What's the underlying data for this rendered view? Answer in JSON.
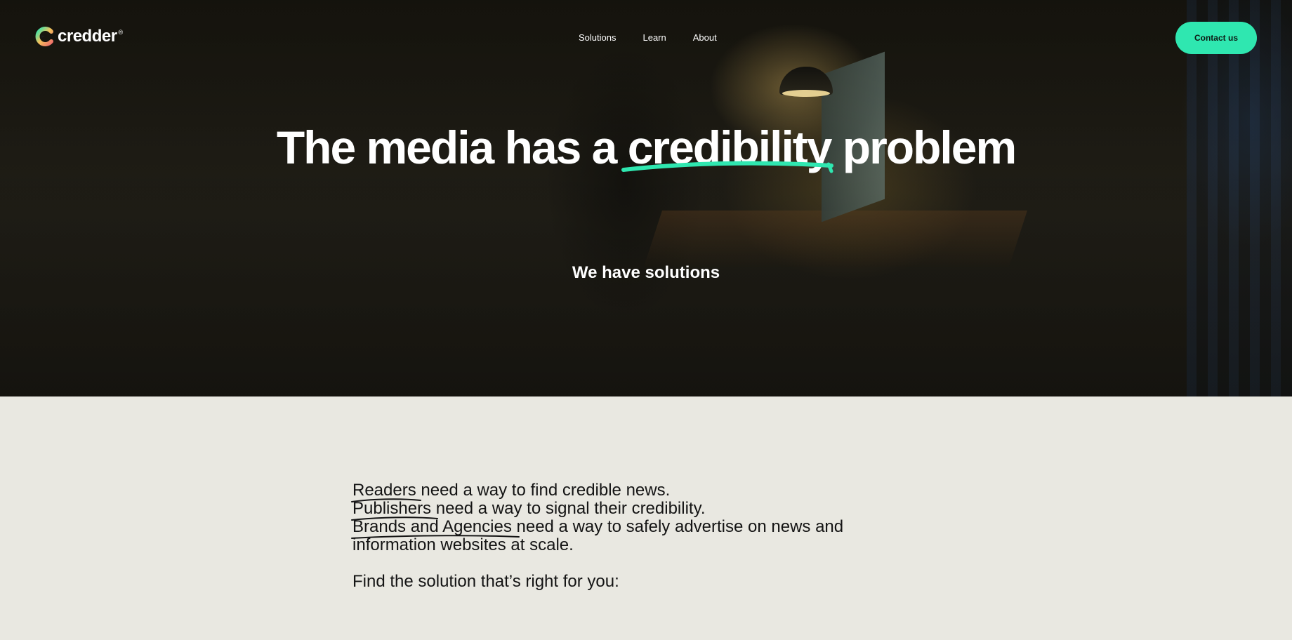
{
  "brand": {
    "name": "credder",
    "reg": "®"
  },
  "nav": {
    "items": [
      "Solutions",
      "Learn",
      "About"
    ]
  },
  "header": {
    "contact_label": "Contact us"
  },
  "hero": {
    "headline_start": "The media has a ",
    "headline_highlight": "credibility",
    "headline_end": " problem",
    "subheading": "We have solutions"
  },
  "content": {
    "lines": [
      {
        "keyword": "Readers",
        "rest": " need a way to find credible news."
      },
      {
        "keyword": "Publishers",
        "rest": " need a way to signal their credibility."
      },
      {
        "keyword": "Brands and Agencies",
        "rest": " need a way to safely advertise on news and information websites at scale."
      }
    ],
    "cta": "Find the solution that’s right for you:"
  },
  "colors": {
    "accent": "#2fe7b0",
    "page_bg": "#e9e8e1",
    "text_dark": "#141414"
  }
}
